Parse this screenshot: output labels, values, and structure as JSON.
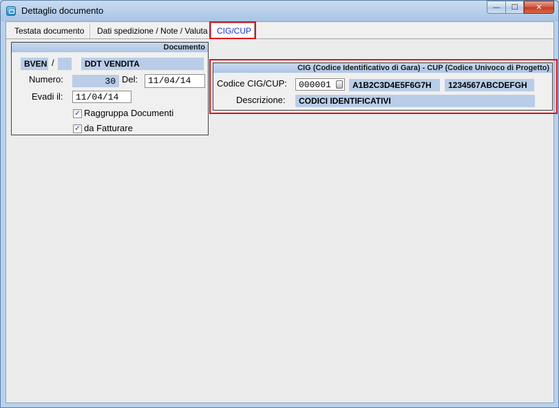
{
  "window": {
    "title": "Dettaglio documento",
    "controls": {
      "minimize": "—",
      "maximize": "☐",
      "close": "✕"
    }
  },
  "tabs": [
    "Testata documento",
    "Dati spedizione / Note / Valuta",
    "CIG/CUP"
  ],
  "documento": {
    "header": "Documento",
    "codice": "BVEN",
    "separator": "/",
    "serie": "",
    "tipo": "DDT VENDITA",
    "numero_label": "Numero:",
    "numero": "30",
    "del_label": "Del:",
    "del": "11/04/14",
    "evadi_label": "Evadi il:",
    "evadi": "11/04/14",
    "raggruppa_label": "Raggruppa Documenti",
    "raggruppa_checked": true,
    "fatturare_label": "da Fatturare",
    "fatturare_checked": true
  },
  "cig_cup": {
    "header": "CIG (Codice Identificativo di Gara) - CUP (Codice Univoco di Progetto)",
    "codice_label": "Codice CIG/CUP:",
    "codice": "000001",
    "cig": "A1B2C3D4E5F6G7H",
    "cup": "1234567ABCDEFGH",
    "descrizione_label": "Descrizione:",
    "descrizione": "CODICI IDENTIFICATIVI"
  }
}
